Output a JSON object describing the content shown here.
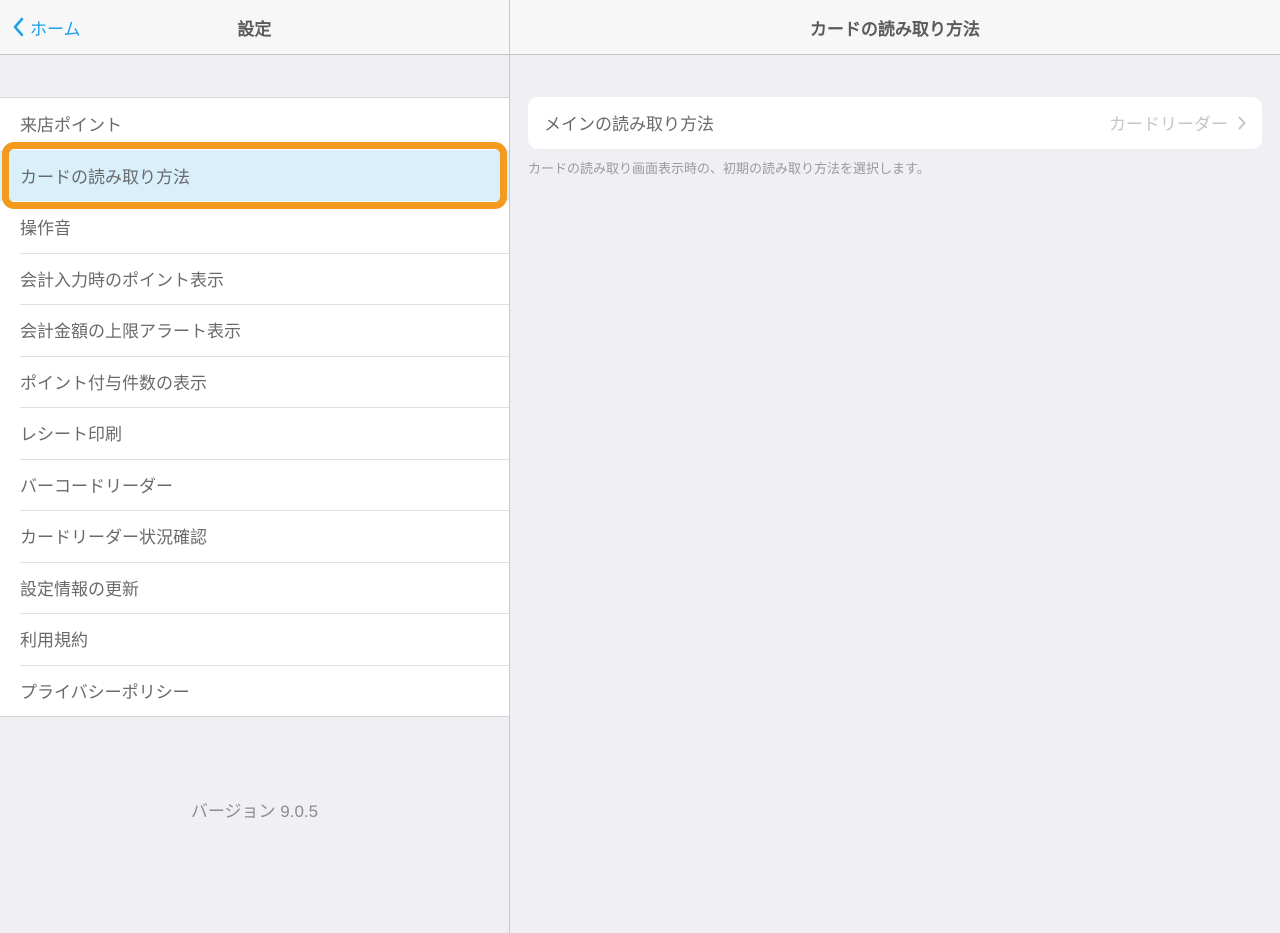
{
  "left": {
    "back_label": "ホーム",
    "title": "設定",
    "items": [
      {
        "label": "来店ポイント",
        "selected": false
      },
      {
        "label": "カードの読み取り方法",
        "selected": true,
        "highlighted": true
      },
      {
        "label": "操作音",
        "selected": false
      },
      {
        "label": "会計入力時のポイント表示",
        "selected": false
      },
      {
        "label": "会計金額の上限アラート表示",
        "selected": false
      },
      {
        "label": "ポイント付与件数の表示",
        "selected": false
      },
      {
        "label": "レシート印刷",
        "selected": false
      },
      {
        "label": "バーコードリーダー",
        "selected": false
      },
      {
        "label": "カードリーダー状況確認",
        "selected": false
      },
      {
        "label": "設定情報の更新",
        "selected": false
      },
      {
        "label": "利用規約",
        "selected": false
      },
      {
        "label": "プライバシーポリシー",
        "selected": false
      }
    ],
    "version": "バージョン 9.0.5"
  },
  "right": {
    "title": "カードの読み取り方法",
    "item_label": "メインの読み取り方法",
    "item_value": "カードリーダー",
    "footer": "カードの読み取り画面表示時の、初期の読み取り方法を選択します。"
  }
}
